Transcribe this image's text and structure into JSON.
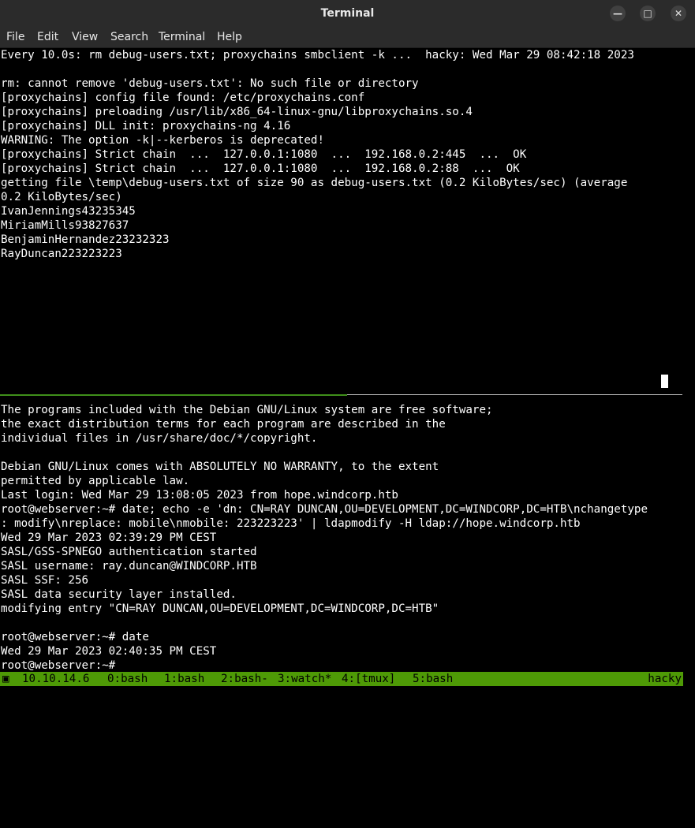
{
  "window": {
    "title": "Terminal",
    "minimize_glyph": "—",
    "maximize_glyph": "□",
    "close_glyph": "✕"
  },
  "menu": [
    "File",
    "Edit",
    "View",
    "Search",
    "Terminal",
    "Help"
  ],
  "top_pane": [
    "Every 10.0s: rm debug-users.txt; proxychains smbclient -k ...  hacky: Wed Mar 29 08:42:18 2023",
    "",
    "rm: cannot remove 'debug-users.txt': No such file or directory",
    "[proxychains] config file found: /etc/proxychains.conf",
    "[proxychains] preloading /usr/lib/x86_64-linux-gnu/libproxychains.so.4",
    "[proxychains] DLL init: proxychains-ng 4.16",
    "WARNING: The option -k|--kerberos is deprecated!",
    "[proxychains] Strict chain  ...  127.0.0.1:1080  ...  192.168.0.2:445  ...  OK",
    "[proxychains] Strict chain  ...  127.0.0.1:1080  ...  192.168.0.2:88  ...  OK",
    "getting file \\temp\\debug-users.txt of size 90 as debug-users.txt (0.2 KiloBytes/sec) (average",
    "0.2 KiloBytes/sec)",
    "IvanJennings43235345",
    "MiriamMills93827637",
    "BenjaminHernandez23232323",
    "RayDuncan223223223"
  ],
  "bottom_pane": [
    "The programs included with the Debian GNU/Linux system are free software;",
    "the exact distribution terms for each program are described in the",
    "individual files in /usr/share/doc/*/copyright.",
    "",
    "Debian GNU/Linux comes with ABSOLUTELY NO WARRANTY, to the extent",
    "permitted by applicable law.",
    "Last login: Wed Mar 29 13:08:05 2023 from hope.windcorp.htb",
    "root@webserver:~# date; echo -e 'dn: CN=RAY DUNCAN,OU=DEVELOPMENT,DC=WINDCORP,DC=HTB\\nchangetype",
    ": modify\\nreplace: mobile\\nmobile: 223223223' | ldapmodify -H ldap://hope.windcorp.htb",
    "Wed 29 Mar 2023 02:39:29 PM CEST",
    "SASL/GSS-SPNEGO authentication started",
    "SASL username: ray.duncan@WINDCORP.HTB",
    "SASL SSF: 256",
    "SASL data security layer installed.",
    "modifying entry \"CN=RAY DUNCAN,OU=DEVELOPMENT,DC=WINDCORP,DC=HTB\"",
    "",
    "root@webserver:~# date",
    "Wed 29 Mar 2023 02:40:35 PM CEST",
    "root@webserver:~# "
  ],
  "status_bar": {
    "icon": "terminal-icon",
    "host": "10.10.14.6",
    "windows": [
      "0:bash",
      "1:bash",
      "2:bash-",
      "3:watch*",
      "4:[tmux]",
      "5:bash"
    ],
    "session": "hacky",
    "bg_color": "#4e9a06"
  },
  "colors": {
    "terminal_bg": "#000000",
    "terminal_fg": "#ffffff",
    "active_pane_border": "#3f8f1a",
    "titlebar_bg": "#2b2b2b"
  }
}
